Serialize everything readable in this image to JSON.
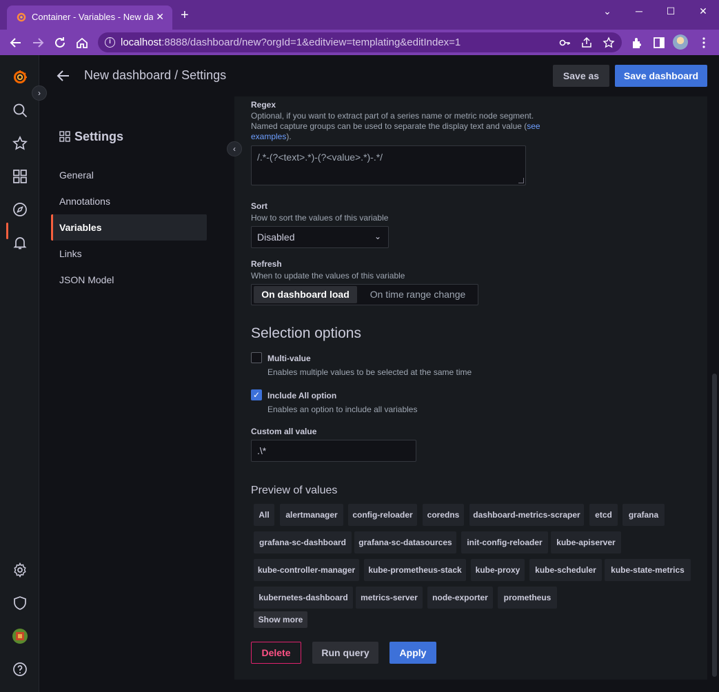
{
  "browser": {
    "tab_title": "Container - Variables - New dash",
    "tab_close": "✕",
    "new_tab": "+",
    "minimize": "─",
    "maximize": "☐",
    "close": "✕",
    "restore_down": "⌄",
    "url_host": "localhost",
    "url_rest": ":8888/dashboard/new?orgId=1&editview=templating&editIndex=1"
  },
  "header": {
    "title": "New dashboard / Settings",
    "save_as": "Save as",
    "save_dashboard": "Save dashboard"
  },
  "settings_nav": {
    "heading": "Settings",
    "items": [
      {
        "label": "General"
      },
      {
        "label": "Annotations"
      },
      {
        "label": "Variables"
      },
      {
        "label": "Links"
      },
      {
        "label": "JSON Model"
      }
    ],
    "active_index": 2
  },
  "regex": {
    "label": "Regex",
    "desc_line1": "Optional, if you want to extract part of a series name or metric node segment.",
    "desc_line2": "Named capture groups can be used to separate the display text and value (",
    "link_see": "see",
    "link_examples": "examples",
    "desc_end": ").",
    "value": "/.*-(?<text>.*)-(?<value>.*)-.*/"
  },
  "sort": {
    "label": "Sort",
    "desc": "How to sort the values of this variable",
    "value": "Disabled"
  },
  "refresh": {
    "label": "Refresh",
    "desc": "When to update the values of this variable",
    "options": [
      "On dashboard load",
      "On time range change"
    ],
    "selected": "On dashboard load"
  },
  "selection": {
    "heading": "Selection options",
    "multi_value_label": "Multi-value",
    "multi_value_desc": "Enables multiple values to be selected at the same time",
    "multi_value_checked": false,
    "include_all_label": "Include All option",
    "include_all_desc": "Enables an option to include all variables",
    "include_all_checked": true,
    "custom_all_label": "Custom all value",
    "custom_all_value": ".\\*"
  },
  "preview": {
    "heading": "Preview of values",
    "values": [
      "All",
      "alertmanager",
      "config-reloader",
      "coredns",
      "dashboard-metrics-scraper",
      "etcd",
      "grafana",
      "grafana-sc-dashboard",
      "grafana-sc-datasources",
      "init-config-reloader",
      "kube-apiserver",
      "kube-controller-manager",
      "kube-prometheus-stack",
      "kube-proxy",
      "kube-scheduler",
      "kube-state-metrics",
      "kubernetes-dashboard",
      "metrics-server",
      "node-exporter",
      "prometheus"
    ],
    "show_more": "Show more"
  },
  "actions": {
    "delete": "Delete",
    "run_query": "Run query",
    "apply": "Apply"
  },
  "colors": {
    "accent_orange": "#f55f3e",
    "primary_blue": "#3d71d9",
    "danger": "#e0226e",
    "browser_purple": "#7a3fb0"
  }
}
